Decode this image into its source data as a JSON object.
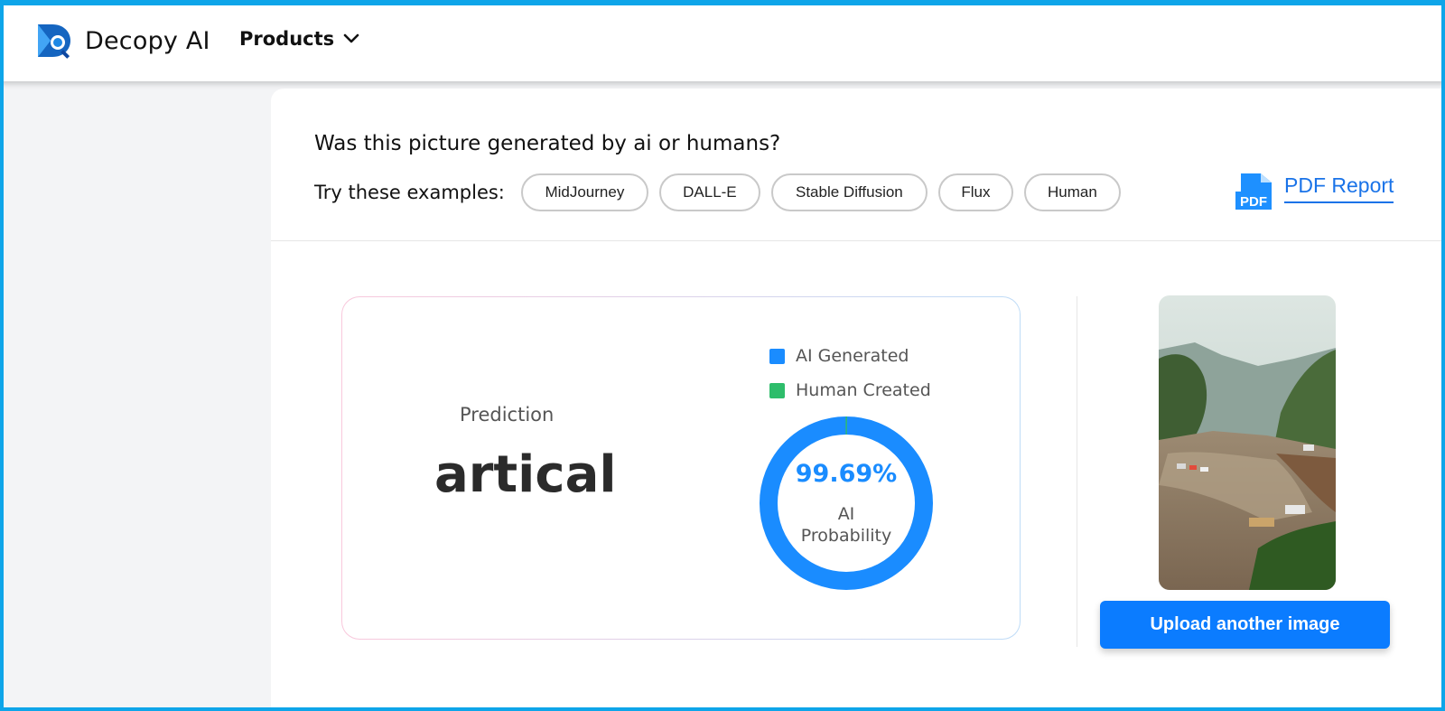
{
  "header": {
    "brand": "Decopy AI",
    "products_label": "Products",
    "logo_icon": "decopy-logo-icon",
    "chevron_icon": "chevron-down-icon"
  },
  "main": {
    "question": "Was this picture generated by ai or humans?",
    "examples_label": "Try these examples:",
    "examples": [
      "MidJourney",
      "DALL-E",
      "Stable Diffusion",
      "Flux",
      "Human"
    ],
    "pdf_report_label": "PDF Report",
    "pdf_icon_text": "PDF"
  },
  "result": {
    "prediction_label": "Prediction",
    "prediction_value": "artical",
    "legend": [
      {
        "label": "AI Generated",
        "color": "#1a8cff"
      },
      {
        "label": "Human Created",
        "color": "#2ebd6b"
      }
    ],
    "ai_probability": 99.69,
    "ai_probability_text": "99.69%",
    "probability_caption_line1": "AI",
    "probability_caption_line2": "Probability"
  },
  "upload": {
    "button_label": "Upload another image"
  },
  "colors": {
    "accent": "#0b7cff",
    "ai": "#1a8cff",
    "human": "#2ebd6b",
    "frame": "#0ea5e9"
  }
}
